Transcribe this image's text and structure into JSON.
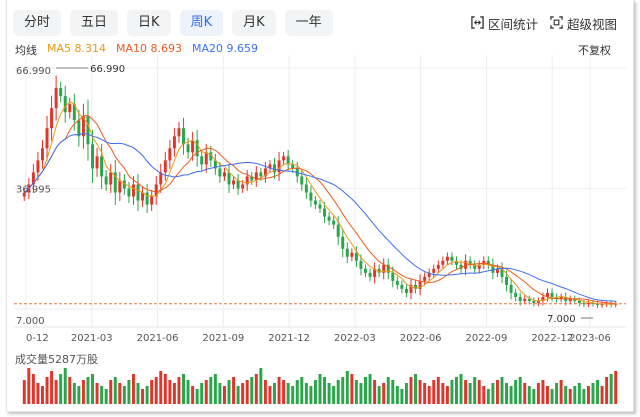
{
  "tabs": [
    "分时",
    "五日",
    "日K",
    "周K",
    "月K",
    "一年"
  ],
  "active_tab": "周K",
  "tools": {
    "range_stats": "区间统计",
    "super_view": "超级视图"
  },
  "icons": {
    "range_stats": "bracket-range-icon",
    "super_view": "expand-frame-icon"
  },
  "ma": {
    "label": "均线",
    "ma5": "MA5 8.314",
    "ma10": "MA10 8.693",
    "ma20": "MA20 9.659"
  },
  "adjust": "不复权",
  "volume_label": "成交量5287万股",
  "colors": {
    "up": "#e0352b",
    "down": "#2aa54b",
    "ma5": "#e99a16",
    "ma10": "#ea5b1c",
    "ma20": "#3d6ff0",
    "active_tab": "#2f6bff"
  },
  "chart_data": {
    "type": "candlestick",
    "x_ticks": [
      "0-12",
      "2021-03",
      "2021-06",
      "2021-09",
      "2021-12",
      "2022-03",
      "2022-06",
      "2022-09",
      "2022-12",
      "2023-06"
    ],
    "y_labels": [
      "66.990",
      "36.995",
      "7.000"
    ],
    "max_marker": "66.990",
    "min_marker": "7.000",
    "ylim": [
      7.0,
      66.99
    ],
    "series": [
      {
        "name": "MA5",
        "value": 8.314
      },
      {
        "name": "MA10",
        "value": 8.693
      },
      {
        "name": "MA20",
        "value": 9.659
      }
    ],
    "close": [
      36,
      38,
      41,
      44,
      47,
      52,
      57,
      62,
      60,
      56,
      58,
      54,
      50,
      55,
      48,
      42,
      45,
      40,
      38,
      41,
      36,
      39,
      37,
      35,
      38,
      34,
      36,
      33,
      35,
      38,
      41,
      44,
      47,
      50,
      52,
      48,
      46,
      49,
      45,
      43,
      46,
      44,
      42,
      40,
      41,
      38,
      39,
      37,
      38,
      40,
      39,
      41,
      40,
      42,
      43,
      41,
      44,
      45,
      43,
      42,
      40,
      38,
      36,
      34,
      33,
      32,
      30,
      29,
      28,
      25,
      22,
      20,
      21,
      19,
      17,
      16,
      15,
      17,
      16,
      18,
      16,
      14,
      13,
      12,
      11,
      13,
      12,
      14,
      15,
      16,
      17,
      18,
      19,
      20,
      19,
      18,
      17,
      19,
      18,
      17,
      18,
      19,
      18,
      16,
      17,
      15,
      13,
      11,
      10,
      9,
      9.5,
      9,
      8.5,
      9,
      10,
      11,
      10,
      9.5,
      10,
      9,
      9.5,
      9,
      8.5,
      8.2,
      8.5,
      8.3,
      8.0,
      8.2,
      8.4,
      8.1,
      8.3
    ],
    "volume": [
      8,
      12,
      10,
      7,
      6,
      9,
      11,
      8,
      10,
      12,
      9,
      7,
      6,
      8,
      9,
      10,
      7,
      6,
      5,
      8,
      9,
      7,
      6,
      8,
      10,
      7,
      5,
      6,
      8,
      9,
      11,
      10,
      8,
      7,
      9,
      10,
      8,
      6,
      5,
      7,
      8,
      9,
      10,
      7,
      6,
      8,
      9,
      6,
      7,
      8,
      9,
      10,
      12,
      8,
      6,
      7,
      9,
      8,
      7,
      6,
      8,
      9,
      7,
      6,
      8,
      10,
      9,
      7,
      6,
      8,
      9,
      11,
      10,
      8,
      7,
      9,
      10,
      8,
      6,
      7,
      9,
      8,
      6,
      5,
      7,
      9,
      10,
      8,
      7,
      6,
      8,
      9,
      7,
      6,
      8,
      9,
      10,
      8,
      7,
      9,
      8,
      6,
      5,
      7,
      8,
      9,
      7,
      6,
      8,
      9,
      7,
      6,
      5,
      7,
      8,
      6,
      5,
      7,
      8,
      6,
      5,
      6,
      7,
      5,
      6,
      7,
      8,
      6,
      9,
      10,
      11
    ]
  }
}
